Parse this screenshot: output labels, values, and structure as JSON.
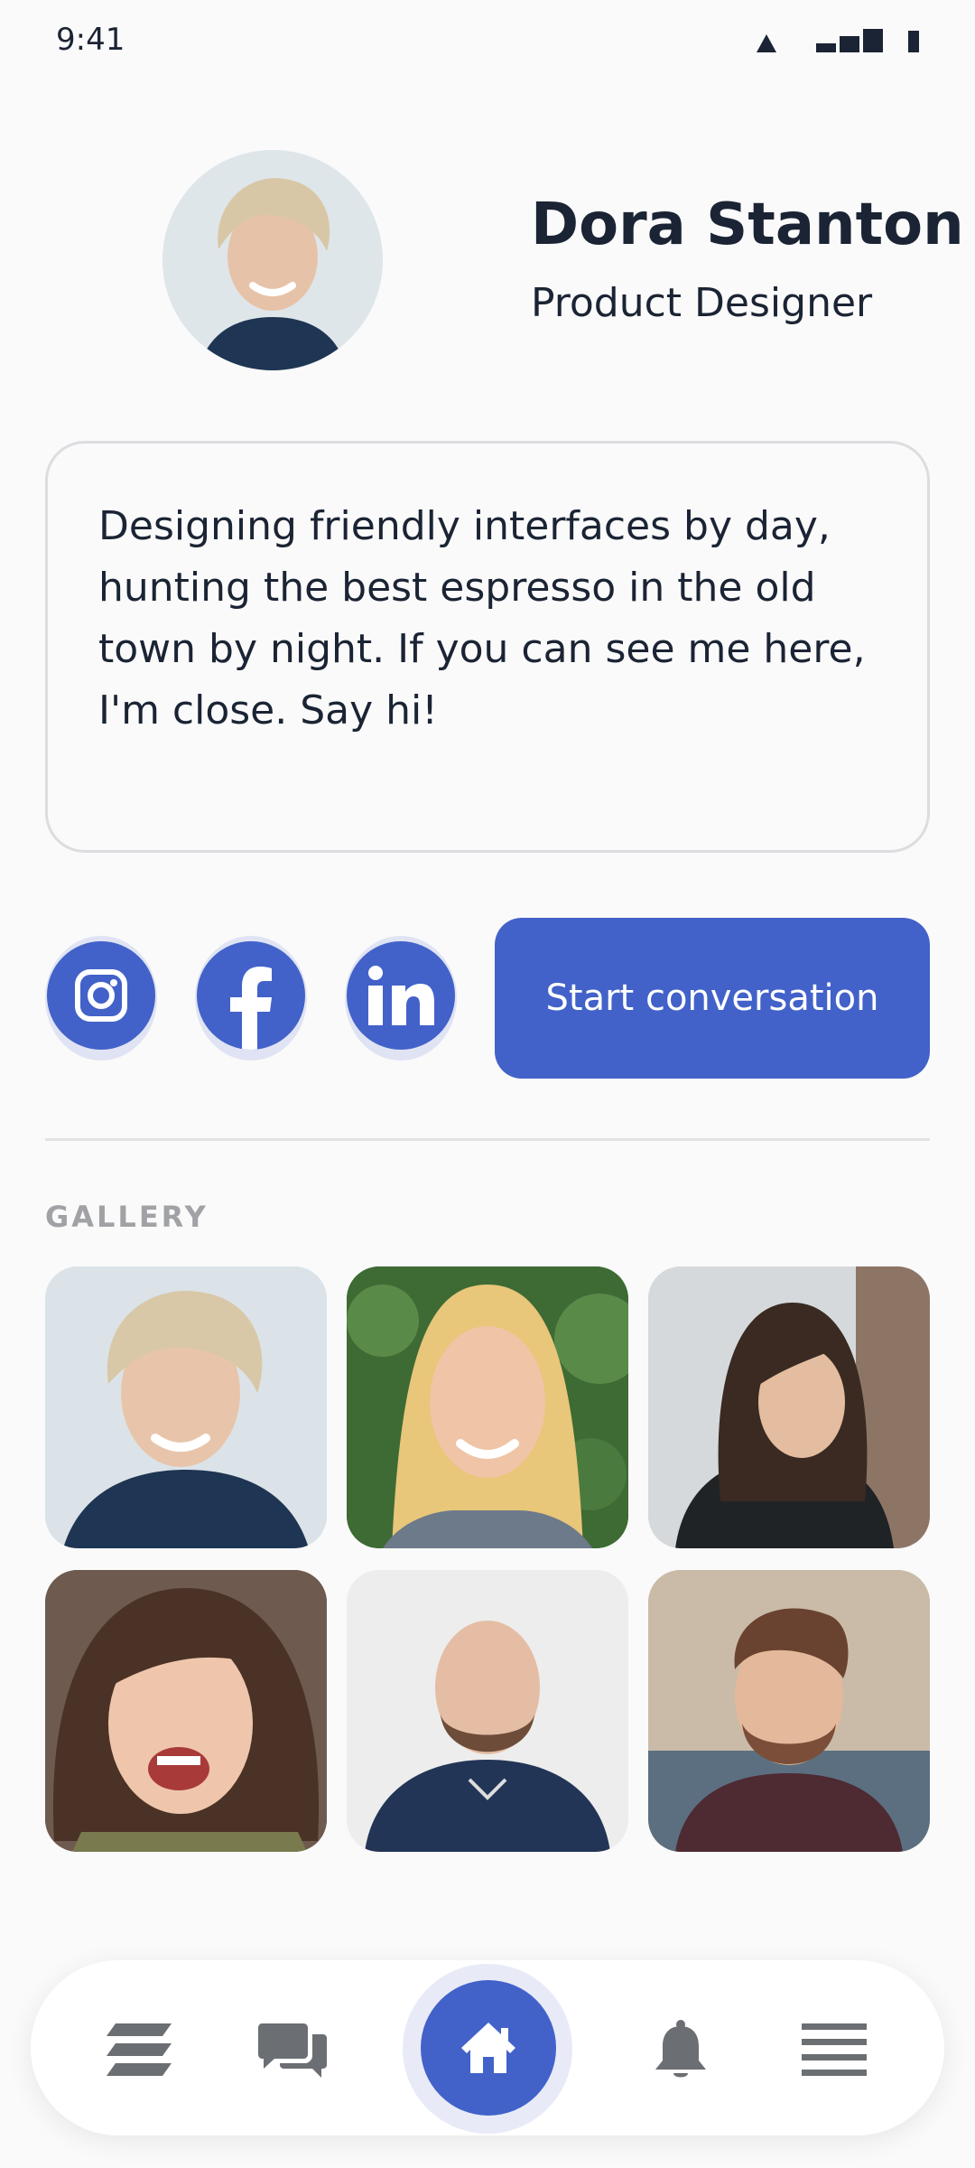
{
  "status_bar": {
    "time": "9:41"
  },
  "profile": {
    "name": "Dora Stanton",
    "role": "Product Designer",
    "avatar_icon": "person-photo"
  },
  "bio": {
    "text": "Designing friendly interfaces by day, hunting the best espresso in the old town by night. If you can see me here, I'm close. Say hi!"
  },
  "social": {
    "items": [
      {
        "icon": "instagram-icon"
      },
      {
        "icon": "facebook-icon"
      },
      {
        "icon": "linkedin-icon"
      }
    ],
    "cta_label": "Start conversation"
  },
  "gallery": {
    "label": "GALLERY",
    "photos": [
      "photo",
      "photo",
      "photo",
      "photo",
      "photo",
      "photo"
    ]
  },
  "bottom_nav": {
    "items": [
      "feed-icon",
      "chat-icon",
      "home-icon",
      "bell-icon",
      "menu-icon"
    ],
    "active": "home-icon"
  },
  "colors": {
    "accent": "#4262c9",
    "text": "#1b2434",
    "muted": "#a1a2a5",
    "background": "#fafafa"
  }
}
